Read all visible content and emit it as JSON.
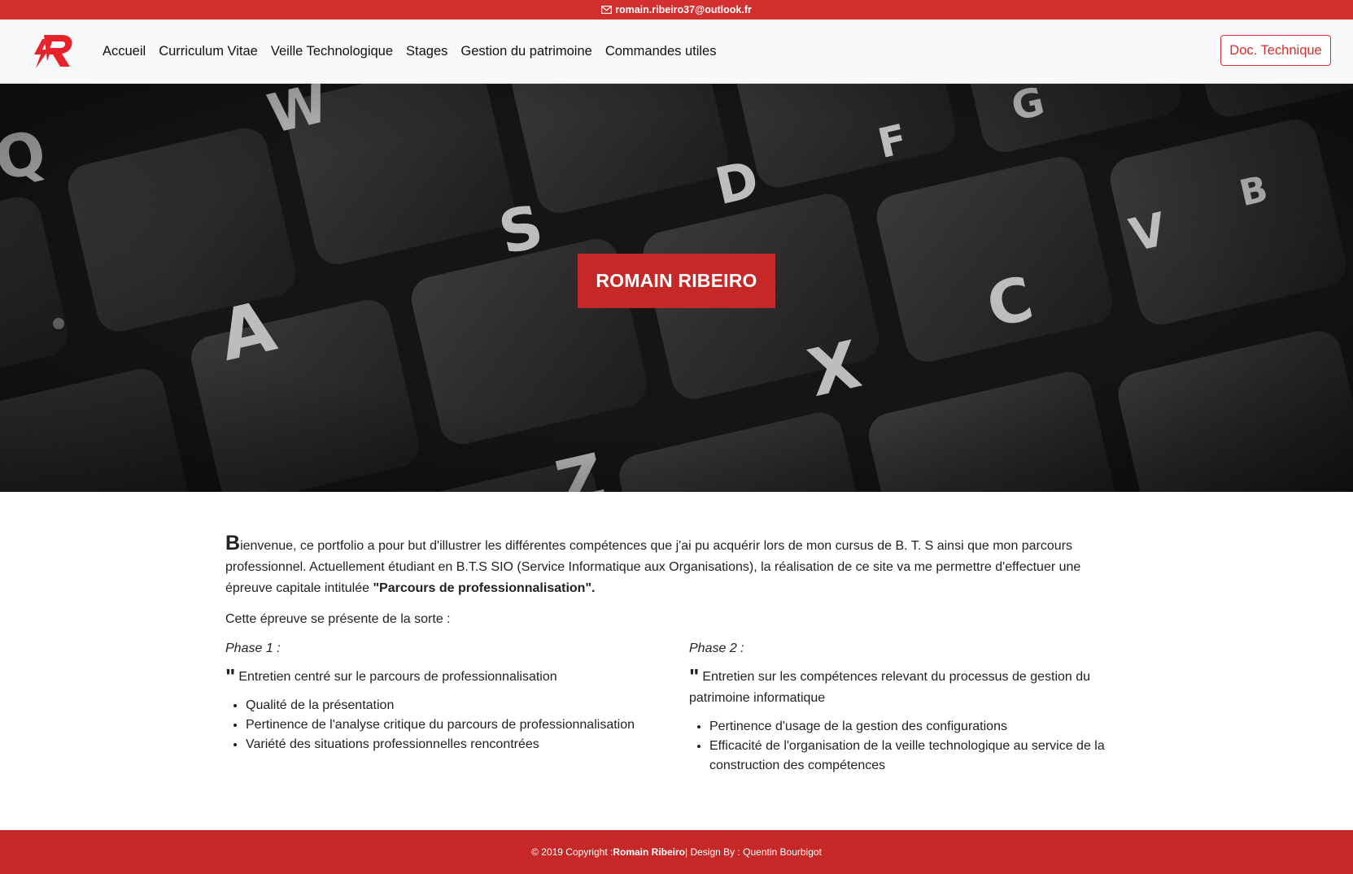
{
  "topbar": {
    "email": "romain.ribeiro37@outlook.fr"
  },
  "navbar": {
    "items": [
      {
        "label": "Accueil"
      },
      {
        "label": "Curriculum Vitae"
      },
      {
        "label": "Veille Technologique"
      },
      {
        "label": "Stages"
      },
      {
        "label": "Gestion du patrimoine"
      },
      {
        "label": "Commandes utiles"
      }
    ],
    "doc_button": "Doc. Technique"
  },
  "hero": {
    "title": "ROMAIN RIBEIRO",
    "key_letters": [
      "Q",
      "W",
      "S",
      "A",
      "D",
      "F",
      "G",
      "C",
      "V",
      "B",
      "X",
      "Z"
    ]
  },
  "content": {
    "intro_dropcap": "B",
    "intro_text": "ienvenue, ce portfolio a pour but d'illustrer les différentes compétences que j'ai pu acquérir lors de mon cursus de B. T. S ainsi que mon parcours professionnel. Actuellement étudiant en B.T.S SIO (Service Informatique aux Organisations), la réalisation de ce site va me permettre d'effectuer une épreuve capitale intitulée ",
    "intro_bold": "\"Parcours de professionnalisation\".",
    "subtitle": "Cette épreuve se présente de la sorte :",
    "phases": [
      {
        "label": "Phase 1 :",
        "quote": "Entretien centré sur le parcours de professionnalisation",
        "items": [
          "Qualité de la présentation",
          "Pertinence de l'analyse critique du parcours de professionnalisation",
          "Variété des situations professionnelles rencontrées"
        ]
      },
      {
        "label": "Phase 2 :",
        "quote": "Entretien sur les compétences relevant du processus de gestion du patrimoine informatique",
        "items": [
          "Pertinence d'usage de la gestion des configurations",
          "Efficacité de l'organisation de la veille technologique au service de la construction des compétences"
        ]
      }
    ]
  },
  "footer": {
    "prefix": "© 2019 Copyright : ",
    "author": "Romain Ribeiro",
    "suffix": " | Design By : Quentin Bourbigot"
  },
  "colors": {
    "brand_red": "#d32f2f",
    "dark_red": "#c62828",
    "navbar_bg": "#f8f9fa"
  }
}
